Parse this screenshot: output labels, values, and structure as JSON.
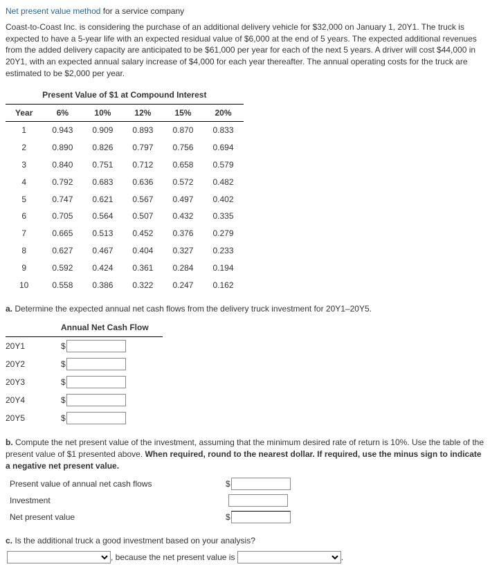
{
  "title": {
    "link": "Net present value method",
    "rest": " for a service company"
  },
  "problem": "Coast-to-Coast Inc. is considering the purchase of an additional delivery vehicle for $32,000 on January 1, 20Y1. The truck is expected to have a 5-year life with an expected residual value of $6,000 at the end of 5 years. The expected additional revenues from the added delivery capacity are anticipated to be $61,000 per year for each of the next 5 years. A driver will cost $44,000 in 20Y1, with an expected annual salary increase of $4,000 for each year thereafter. The annual operating costs for the truck are estimated to be $2,000 per year.",
  "pv": {
    "caption": "Present Value of $1 at Compound Interest",
    "headers": [
      "Year",
      "6%",
      "10%",
      "12%",
      "15%",
      "20%"
    ],
    "rows": [
      [
        "1",
        "0.943",
        "0.909",
        "0.893",
        "0.870",
        "0.833"
      ],
      [
        "2",
        "0.890",
        "0.826",
        "0.797",
        "0.756",
        "0.694"
      ],
      [
        "3",
        "0.840",
        "0.751",
        "0.712",
        "0.658",
        "0.579"
      ],
      [
        "4",
        "0.792",
        "0.683",
        "0.636",
        "0.572",
        "0.482"
      ],
      [
        "5",
        "0.747",
        "0.621",
        "0.567",
        "0.497",
        "0.402"
      ],
      [
        "6",
        "0.705",
        "0.564",
        "0.507",
        "0.432",
        "0.335"
      ],
      [
        "7",
        "0.665",
        "0.513",
        "0.452",
        "0.376",
        "0.279"
      ],
      [
        "8",
        "0.627",
        "0.467",
        "0.404",
        "0.327",
        "0.233"
      ],
      [
        "9",
        "0.592",
        "0.424",
        "0.361",
        "0.284",
        "0.194"
      ],
      [
        "10",
        "0.558",
        "0.386",
        "0.322",
        "0.247",
        "0.162"
      ]
    ]
  },
  "a": {
    "prompt_prefix": "a.",
    "prompt": " Determine the expected annual net cash flows from the delivery truck investment for 20Y1–20Y5.",
    "col_header": "Annual Net Cash Flow",
    "years": [
      "20Y1",
      "20Y2",
      "20Y3",
      "20Y4",
      "20Y5"
    ],
    "dollar": "$"
  },
  "b": {
    "prompt_prefix": "b.",
    "prompt": " Compute the net present value of the investment, assuming that the minimum desired rate of return is 10%. Use the table of the present value of $1 presented above. ",
    "prompt_bold": "When required, round to the nearest dollar. If required, use the minus sign to indicate a negative net present value.",
    "rows": [
      "Present value of annual net cash flows",
      "Investment",
      "Net present value"
    ],
    "dollar": "$"
  },
  "c": {
    "prompt_prefix": "c.",
    "prompt": " Is the additional truck a good investment based on your analysis?",
    "mid": ", because the net present value is ",
    "end": "."
  }
}
